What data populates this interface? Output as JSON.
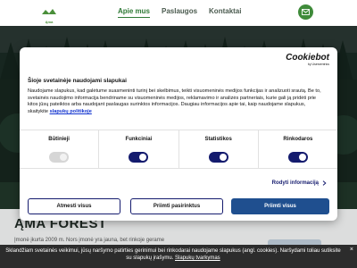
{
  "header": {
    "logo_text": "Ąma",
    "nav": [
      "Apie mus",
      "Paslaugos",
      "Kontaktai"
    ],
    "active_index": 0
  },
  "page": {
    "company_title": "ĄMA FOREST",
    "company_text": "Įmonė įkurta 2009 m. Nors įmonė yra jauna, bet rinkoje gerame"
  },
  "cookie_dialog": {
    "brand": "Cookiebot",
    "brand_sub": "by Usercentrics",
    "title": "Šioje svetainėje naudojami slapukai",
    "text": "Naudojame slapukus, kad galėtume suasmeninti turinį bei skelbimus, teikti visuomeninės medijos funkcijas ir analizuoti srautą. Be to, svetainės naudojimo informacija bendriname su visuomeninės medijos, reklamavimo ir analizės partneriais, kurie gali ją pridėti prie kitos jūsų pateiktos arba naudojant paslaugas surinktos informacijos. Daugiau informacijos apie tai, kaip naudojame slapukus, skaitykite",
    "policy_link": "slapukų politikoje",
    "toggles": [
      {
        "label": "Būtinieji",
        "enabled": false
      },
      {
        "label": "Funkciniai",
        "enabled": true
      },
      {
        "label": "Statistikos",
        "enabled": true
      },
      {
        "label": "Rinkodaros",
        "enabled": true
      }
    ],
    "details_label": "Rodyti informaciją",
    "buttons": {
      "decline": "Atmesti visus",
      "custom": "Priimti pasirinktus",
      "accept_all": "Priimti visus"
    }
  },
  "banner": {
    "text": "Sklandžiam svetainės veikimui, jūsų naršymo patirties gerinimui bei rinkodarai naudojame slapukus (angl. cookies). Naršydami toliau sutiksite su slapukų įrašymu.",
    "link": "Slapukų tvarkymas",
    "close": "×"
  },
  "colors": {
    "brand_green": "#2f7a36",
    "dialog_accent": "#141b6e",
    "accept_button": "#1f4f8f"
  }
}
